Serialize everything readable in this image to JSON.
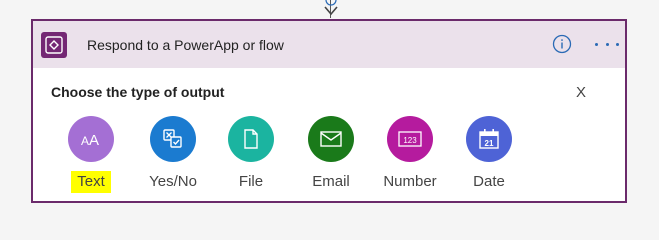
{
  "card": {
    "title": "Respond to a PowerApp or flow",
    "header_icons": {
      "info": "info-icon",
      "more": "more-icon"
    }
  },
  "body": {
    "heading": "Choose the type of output",
    "close_label": "X"
  },
  "options": [
    {
      "label": "Text",
      "icon": "text-icon",
      "color": "#a46fd4",
      "glyph": "AA",
      "highlighted": true
    },
    {
      "label": "Yes/No",
      "icon": "yes-no-icon",
      "color": "#1b7bd0",
      "highlighted": false
    },
    {
      "label": "File",
      "icon": "file-icon",
      "color": "#1bb4a0",
      "highlighted": false
    },
    {
      "label": "Email",
      "icon": "email-icon",
      "color": "#1a7a1a",
      "highlighted": false
    },
    {
      "label": "Number",
      "icon": "number-icon",
      "color": "#b51b9e",
      "glyph": "123",
      "highlighted": false
    },
    {
      "label": "Date",
      "icon": "date-icon",
      "color": "#4e63d6",
      "glyph": "21",
      "highlighted": false
    }
  ],
  "colors": {
    "card_border": "#6b2a6b",
    "header_bg": "#ebe1eb",
    "app_icon_bg": "#742774",
    "accent_blue": "#2a6ab5",
    "highlight": "#ffff00"
  }
}
